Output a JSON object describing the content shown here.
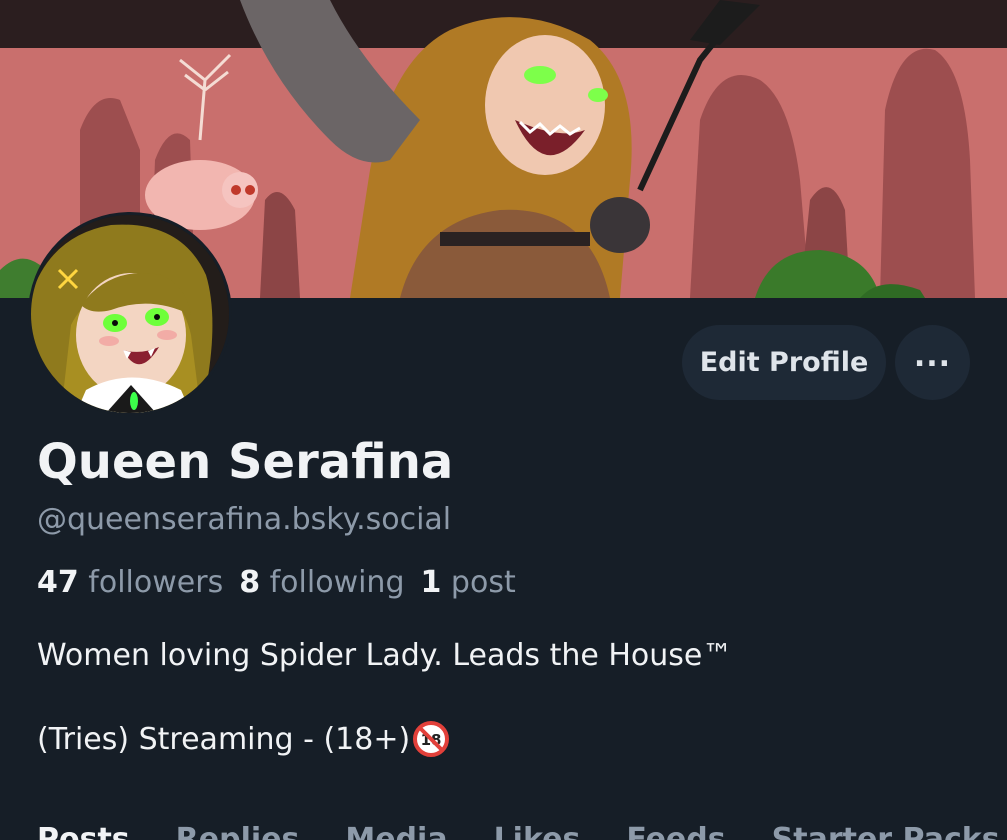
{
  "profile": {
    "display_name": "Queen Serafina",
    "handle": "@queenserafina.bsky.social",
    "followers_count": "47",
    "followers_label": "followers",
    "following_count": "8",
    "following_label": "following",
    "posts_count": "1",
    "posts_label": "post",
    "bio_line1": "Women loving Spider Lady. Leads the House™",
    "bio_line2": "(Tries) Streaming - (18+)"
  },
  "actions": {
    "edit_profile_label": "Edit Profile",
    "more_label": "..."
  },
  "tabs": [
    {
      "label": "Posts",
      "active": true
    },
    {
      "label": "Replies"
    },
    {
      "label": "Media"
    },
    {
      "label": "Likes"
    },
    {
      "label": "Feeds"
    },
    {
      "label": "Starter Packs"
    }
  ],
  "icons": {
    "banner": "banner-image",
    "avatar": "avatar-image",
    "no18": "no-one-under-eighteen-icon",
    "more": "ellipsis-icon"
  },
  "colors": {
    "background": "#161e27",
    "button_bg": "#1e2936",
    "muted_text": "#8d9aa9",
    "banner_pink": "#ca7270"
  }
}
